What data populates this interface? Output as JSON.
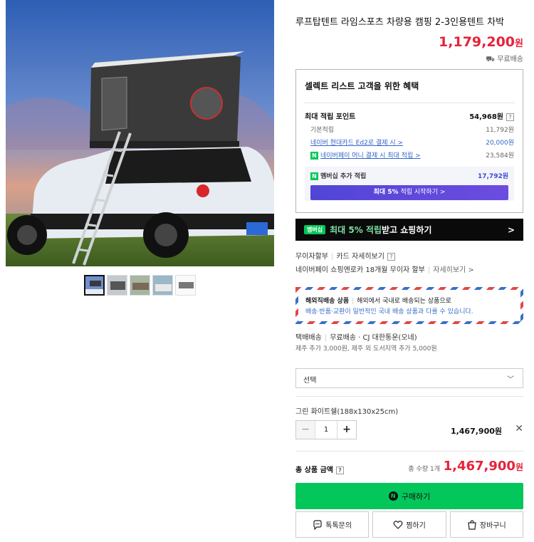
{
  "product": {
    "title": "루프탑텐트 라임스포츠 차량용 캠핑 2-3인용텐트 차박",
    "price": "1,179,200",
    "price_unit": "원",
    "shipping": "무료배송"
  },
  "benefits": {
    "title": "셀렉트 리스트 고객을 위한 혜택",
    "max_points_label": "최대 적립 포인트",
    "max_points": "54,968원",
    "rows": [
      {
        "label": "기본적립",
        "value": "11,792원"
      },
      {
        "label": "네이버 현대카드 Ed2로 결제 시 >",
        "value": "20,000원"
      },
      {
        "label": "네이버페이 머니 결제 시 최대 적립 >",
        "value": "23,584원"
      }
    ],
    "member_label": "멤버십 추가 적립",
    "member_value": "17,792원",
    "member_btn_prefix": "최대 5%",
    "member_btn_suffix": "적립 시작하기 >"
  },
  "banner": {
    "badge": "멤버십",
    "pct": "최대 5% 적립",
    "text": " 받고 쇼핑하기",
    "chevron": ">"
  },
  "installment": {
    "label": "무이자할부",
    "card": "카드 자세히보기",
    "line2": "네이버페이 쇼핑엔로카 18개월 무이자 할부",
    "detail": "자세히보기 >"
  },
  "overseas": {
    "label": "해외직배송 상품",
    "desc": "해외에서 국내로 배송되는 상품으로",
    "desc2": "배송·반품·교환이 일반적인 국내 배송 상품과 다를 수 있습니다."
  },
  "delivery": {
    "method": "택배배송",
    "fee": "무료배송 · CJ 대한통운(오네)",
    "extra": "제주 추가 3,000원, 제주 외 도서지역 추가 5,000원"
  },
  "option": {
    "select_placeholder": "선택",
    "chosen": "그린 화이트쉘(188x130x25cm)",
    "qty": "1",
    "price": "1,467,900원"
  },
  "total": {
    "label": "총 상품 금액",
    "count": "총 수량 1개",
    "price": "1,467,900",
    "unit": "원"
  },
  "buttons": {
    "buy": "구매하기",
    "inquiry": "톡톡문의",
    "wish": "찜하기",
    "cart": "장바구니"
  },
  "colors": {
    "price_red": "#e4233a",
    "naver_green": "#03c75a",
    "member_purple": "#5145d6"
  }
}
